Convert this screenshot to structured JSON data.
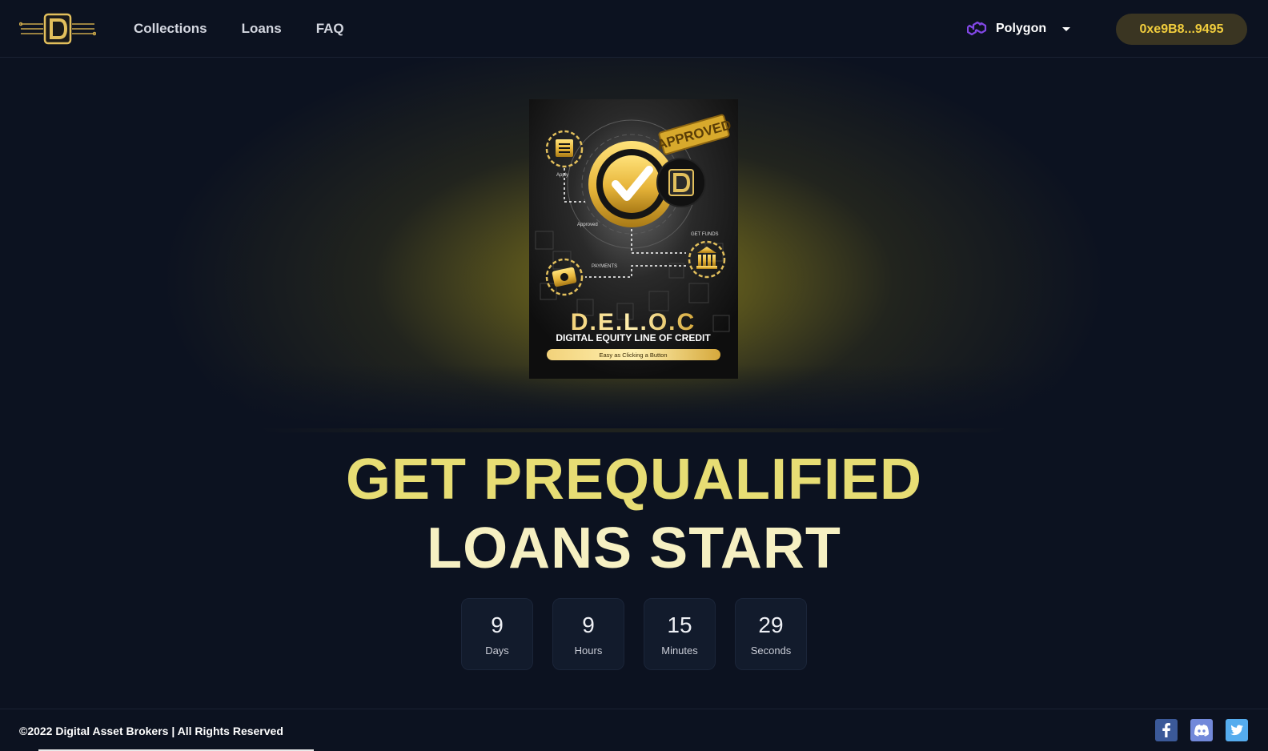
{
  "nav": {
    "links": [
      "Collections",
      "Loans",
      "FAQ"
    ],
    "network": {
      "label": "Polygon",
      "icon": "polygon-icon",
      "color": "#8247e5"
    },
    "wallet": "0xe9B8...9495"
  },
  "poster": {
    "badge": "APPROVED",
    "steps": [
      "Apply",
      "Approved",
      "GET FUNDS",
      "PAYMENTS"
    ],
    "title": "D.E.L.O.C",
    "subtitle": "DIGITAL EQUITY LINE OF CREDIT",
    "tagline": "Easy as Clicking a Button"
  },
  "hero": {
    "line1": "GET PREQUALIFIED",
    "line2": "LOANS START"
  },
  "countdown": [
    {
      "value": "9",
      "unit": "Days"
    },
    {
      "value": "9",
      "unit": "Hours"
    },
    {
      "value": "15",
      "unit": "Minutes"
    },
    {
      "value": "29",
      "unit": "Seconds"
    }
  ],
  "footer": {
    "copyright": "©2022 Digital Asset Brokers | All Rights Reserved",
    "socials": [
      {
        "icon": "facebook-icon",
        "color": "#3b5998"
      },
      {
        "icon": "discord-icon",
        "color": "#7289da"
      },
      {
        "icon": "twitter-icon",
        "color": "#55acee"
      }
    ]
  },
  "colors": {
    "background": "#0c1220",
    "accent": "#f1cd3d",
    "headline_primary": "#e7dd74",
    "headline_secondary": "#f6f0c2"
  }
}
